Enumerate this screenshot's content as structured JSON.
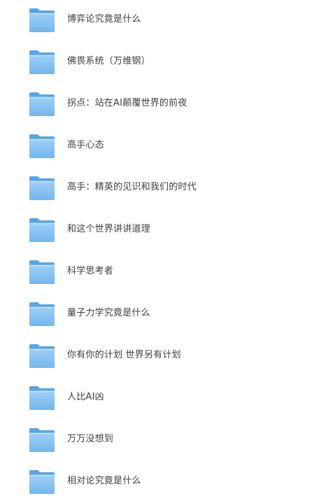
{
  "folders": [
    {
      "name": "博弈论究竟是什么",
      "icon": "folder-icon"
    },
    {
      "name": "佛畏系统（万维钢）",
      "icon": "folder-icon"
    },
    {
      "name": "拐点：站在AI颠覆世界的前夜",
      "icon": "folder-icon"
    },
    {
      "name": "高手心态",
      "icon": "folder-icon"
    },
    {
      "name": "高手：精英的见识和我们的时代",
      "icon": "folder-icon"
    },
    {
      "name": "和这个世界讲讲道理",
      "icon": "folder-icon"
    },
    {
      "name": "科学思考者",
      "icon": "folder-icon"
    },
    {
      "name": "量子力学究竟是什么",
      "icon": "folder-icon"
    },
    {
      "name": "你有你的计划 世界另有计划",
      "icon": "folder-icon"
    },
    {
      "name": "人比AI凶",
      "icon": "folder-icon"
    },
    {
      "name": "万万没想到",
      "icon": "folder-icon"
    },
    {
      "name": "相对论究竟是什么",
      "icon": "folder-icon"
    }
  ],
  "colors": {
    "folder_back": "#5aa4e6",
    "folder_front_top": "#9fd0f7",
    "folder_front_bottom": "#74b6ee",
    "label_text": "#404040"
  }
}
